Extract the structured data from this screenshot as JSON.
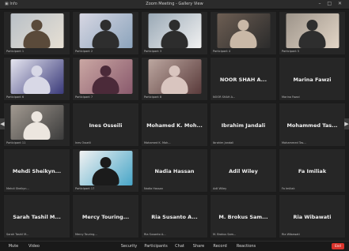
{
  "window": {
    "title": "Zoom Meeting - Gallery View",
    "left_menu": "▣  Info",
    "controls": "– □ ✕"
  },
  "colors": {
    "tile_bg": "#262626",
    "end_button": "#d9332c"
  },
  "tiles": [
    {
      "name": "",
      "caption": "Participant 1",
      "video": true
    },
    {
      "name": "",
      "caption": "Participant 2",
      "video": true
    },
    {
      "name": "",
      "caption": "Participant 3",
      "video": true
    },
    {
      "name": "",
      "caption": "Participant 4",
      "video": true
    },
    {
      "name": "",
      "caption": "Participant 5",
      "video": true
    },
    {
      "name": "",
      "caption": "Participant 6",
      "video": true
    },
    {
      "name": "",
      "caption": "Participant 7",
      "video": true
    },
    {
      "name": "",
      "caption": "Participant 8",
      "video": true
    },
    {
      "name": "NOOR SHAH A...",
      "caption": "NOOR SHAH A...",
      "video": false
    },
    {
      "name": "Marina Fawzi",
      "caption": "Marina Fawzi",
      "video": false
    },
    {
      "name": "",
      "caption": "Participant 11",
      "video": true
    },
    {
      "name": "Ines Osseili",
      "caption": "Ines Osseili",
      "video": false
    },
    {
      "name": "Mohamed K. Moh...",
      "caption": "Mohamed K. Moh...",
      "video": false
    },
    {
      "name": "Ibrahim Jandali",
      "caption": "Ibrahim Jandali",
      "video": false
    },
    {
      "name": "Mohammed Tas...",
      "caption": "Mohammed Tas...",
      "video": false
    },
    {
      "name": "Mehdi Sheikyn...",
      "caption": "Mehdi Sheikyn...",
      "video": false
    },
    {
      "name": "",
      "caption": "Participant 17",
      "video": true
    },
    {
      "name": "Nadia Hassan",
      "caption": "Nadia Hassan",
      "video": false
    },
    {
      "name": "Adil Wiley",
      "caption": "Adil Wiley",
      "video": false
    },
    {
      "name": "Fa Imiliak",
      "caption": "Fa Imiliak",
      "video": false
    },
    {
      "name": "Sarah Tashil M...",
      "caption": "Sarah Tashil M...",
      "video": false
    },
    {
      "name": "Mercy Touring...",
      "caption": "Mercy Touring...",
      "video": false
    },
    {
      "name": "Ria Susanto A...",
      "caption": "Ria Susanto A...",
      "video": false
    },
    {
      "name": "M. Brokus Sam...",
      "caption": "M. Brokus Sam...",
      "video": false
    },
    {
      "name": "Ria Wibawati",
      "caption": "Ria Wibawati",
      "video": false
    }
  ],
  "toolbar": {
    "left_items": [
      "Mute",
      "Video"
    ],
    "center_items": [
      "Security",
      "Participants",
      "Chat",
      "Share",
      "Record",
      "Reactions"
    ],
    "end_label": "End"
  },
  "nav": {
    "prev": "◀",
    "next": "▶"
  }
}
